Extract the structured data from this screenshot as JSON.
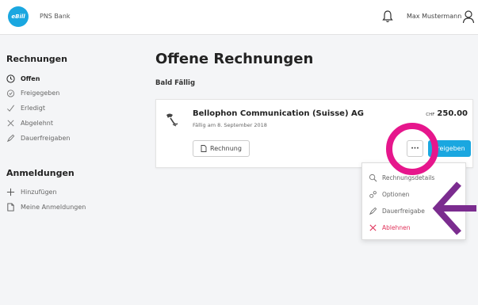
{
  "header": {
    "logo_text": "eBill",
    "bank_name": "PNS Bank",
    "user_name": "Max Mustermann"
  },
  "sidebar": {
    "section1_title": "Rechnungen",
    "items": [
      {
        "label": "Offen",
        "icon": "clock-icon"
      },
      {
        "label": "Freigegeben",
        "icon": "calendar-check-icon"
      },
      {
        "label": "Erledigt",
        "icon": "check-icon"
      },
      {
        "label": "Abgelehnt",
        "icon": "x-icon"
      },
      {
        "label": "Dauerfreigaben",
        "icon": "standing-approval-icon"
      }
    ],
    "section2_title": "Anmeldungen",
    "items2": [
      {
        "label": "Hinzufügen",
        "icon": "plus-icon"
      },
      {
        "label": "Meine Anmeldungen",
        "icon": "document-icon"
      }
    ]
  },
  "main": {
    "title": "Offene Rechnungen",
    "section_label": "Bald Fällig",
    "bill": {
      "biller": "Bellophon Communication (Suisse) AG",
      "due": "Fällig am 8. September 2018",
      "currency": "CHF",
      "amount": "250.00",
      "view_button": "Rechnung",
      "more_button": "···",
      "approve_button": "Freigeben"
    }
  },
  "menu": {
    "items": [
      {
        "label": "Rechnungsdetails",
        "icon": "search-detail-icon"
      },
      {
        "label": "Optionen",
        "icon": "options-icon"
      },
      {
        "label": "Dauerfreigabe",
        "icon": "standing-approval-icon"
      },
      {
        "label": "Ablehnen",
        "icon": "x-icon"
      }
    ]
  },
  "colors": {
    "accent": "#1aa7e0",
    "highlight_ring": "#e6168c",
    "arrow": "#7b2c8f",
    "danger": "#e0325a"
  }
}
